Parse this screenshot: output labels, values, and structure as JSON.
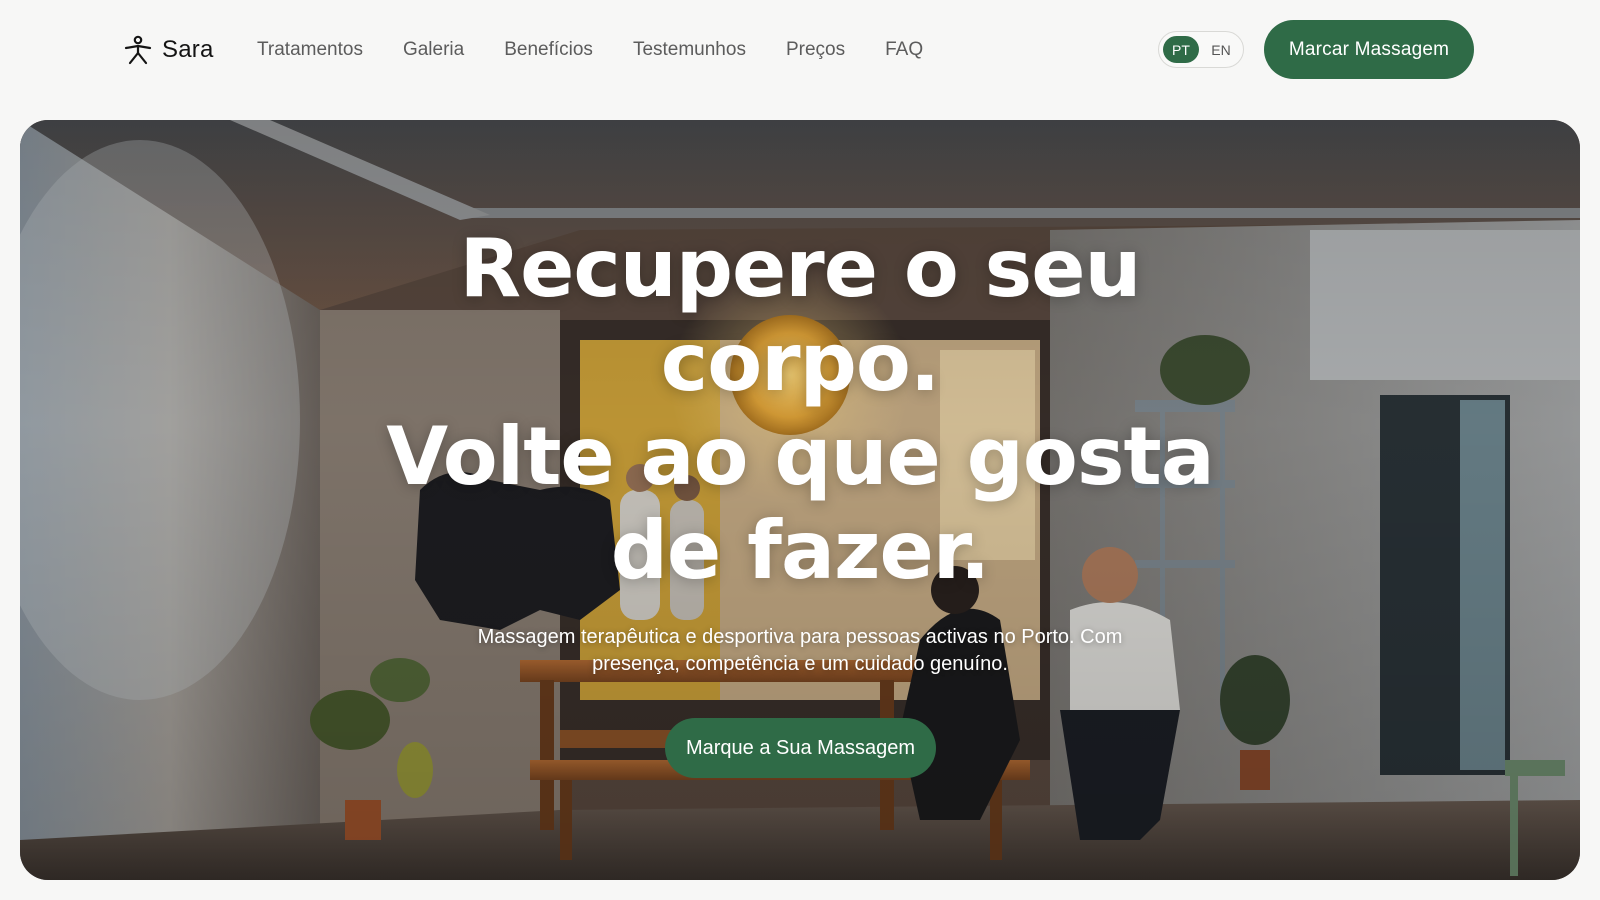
{
  "header": {
    "brand_name": "Sara",
    "nav": [
      "Tratamentos",
      "Galeria",
      "Benefícios",
      "Testemunhos",
      "Preços",
      "FAQ"
    ],
    "language": {
      "options": [
        "PT",
        "EN"
      ],
      "selected": "PT"
    },
    "cta_label": "Marcar Massagem"
  },
  "hero": {
    "title_lines": [
      "Recupere o seu",
      "corpo.",
      "Volte ao que gosta",
      "de fazer."
    ],
    "subtitle": "Massagem terapêutica e desportiva para pessoas activas no Porto. Com presença, competência e um cuidado genuíno.",
    "cta_label": "Marque a Sua Massagem",
    "background": "photo-studio-interior"
  },
  "colors": {
    "accent": "#2f6b47",
    "page_bg": "#f7f7f6",
    "nav_text": "#5c5c5c"
  },
  "icons": {
    "brand": "person-stretch-icon"
  }
}
